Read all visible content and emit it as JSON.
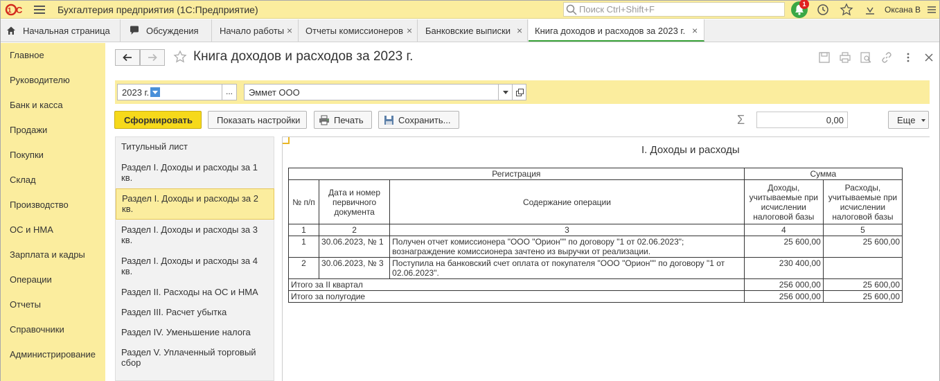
{
  "app": {
    "title": "Бухгалтерия предприятия  (1С:Предприятие)",
    "search_placeholder": "Поиск Ctrl+Shift+F",
    "notifications_count": "1",
    "user": "Оксана В",
    "brand_color": "#fbed9e",
    "logo_text": "1С"
  },
  "tabs": [
    {
      "label": "Начальная страница",
      "icon": "home-icon"
    },
    {
      "label": "Обсуждения",
      "icon": "chat-icon"
    },
    {
      "label": "Начало работы"
    },
    {
      "label": "Отчеты комиссионеров"
    },
    {
      "label": "Банковские выписки"
    },
    {
      "label": "Книга доходов и расходов за 2023 г.",
      "active": true
    }
  ],
  "sidebar": {
    "items": [
      "Главное",
      "Руководителю",
      "Банк и касса",
      "Продажи",
      "Покупки",
      "Склад",
      "Производство",
      "ОС и НМА",
      "Зарплата и кадры",
      "Операции",
      "Отчеты",
      "Справочники",
      "Администрирование"
    ]
  },
  "header": {
    "title": "Книга доходов и расходов за 2023 г."
  },
  "filters": {
    "period": "2023 г.",
    "organization": "Эммет ООО"
  },
  "toolbar": {
    "generate": "Сформировать",
    "show_settings": "Показать настройки",
    "print": "Печать",
    "save": "Сохранить...",
    "sum_value": "0,00",
    "more": "Еще"
  },
  "sections": [
    "Титульный лист",
    "Раздел I. Доходы и расходы за 1 кв.",
    "Раздел I. Доходы и расходы за 2 кв.",
    "Раздел I. Доходы и расходы за 3 кв.",
    "Раздел I. Доходы и расходы за 4 кв.",
    "Раздел II. Расходы на ОС и НМА",
    "Раздел III. Расчет убытка",
    "Раздел IV. Уменьшение налога",
    "Раздел V. Уплаченный торговый сбор"
  ],
  "report": {
    "title": "I. Доходы и расходы",
    "group_registration": "Регистрация",
    "group_sum": "Сумма",
    "col_no": "№ п/п",
    "col_doc": "Дата и номер первичного документа",
    "col_content": "Содержание операции",
    "col_income": "Доходы, учитываемые при исчислении налоговой базы",
    "col_expense": "Расходы, учитываемые при исчислении налоговой базы",
    "col_nums": [
      "1",
      "2",
      "3",
      "4",
      "5"
    ],
    "rows": [
      {
        "no": "1",
        "doc": "30.06.2023, № 1",
        "content": "Получен отчет комиссионера \"ООО \"Орион\"\" по договору \"1 от 02.06.2023\"; вознаграждение комиссионера зачтено из выручки от реализации.",
        "income": "25 600,00",
        "expense": "25 600,00"
      },
      {
        "no": "2",
        "doc": "30.06.2023, № 3",
        "content": "Поступила на банковский счет оплата от покупателя \"ООО \"Орион\"\" по договору \"1 от 02.06.2023\".",
        "income": "230 400,00",
        "expense": ""
      }
    ],
    "totals": [
      {
        "label": "Итого за II квартал",
        "income": "256 000,00",
        "expense": "25 600,00"
      },
      {
        "label": "Итого за полугодие",
        "income": "256 000,00",
        "expense": "25 600,00"
      }
    ]
  }
}
